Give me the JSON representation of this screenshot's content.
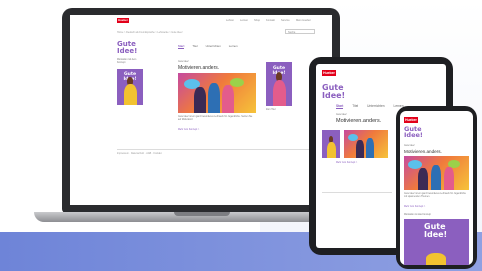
{
  "laptop": {
    "brand_label": "",
    "site": {
      "logo": "Hueber",
      "nav": [
        "Lehren",
        "Lernen",
        "Shop",
        "Kontakt",
        "Service",
        "Mein Hueber"
      ],
      "breadcrumb": "Home > Deutsch als Fremdsprache > Lehrwerke > Gute Idee!",
      "search_placeholder": "Suche",
      "logo_line1": "Gute",
      "logo_line2": "Idee!",
      "side_text": "Motivation mit dem Konzept",
      "tabs": [
        "Start",
        "Titel",
        "Unterrichten",
        "Lernen"
      ],
      "section_kicker": "Gute Idee!",
      "section_title": "Motivieren.anders.",
      "body_text": "Gute Idee! ist ein ganz besonderes Lehrwerk für Jugendliche. Setzen Sie auf Motivation!",
      "more_link": "Mehr zum Konzept >",
      "side_cover_label": "Gute Idee!",
      "side_caption": "Zum Titel",
      "footer_text": "Impressum · Datenschutz · AGB · Kontakt"
    }
  },
  "tablet": {
    "logo": "Hueber",
    "logo_line1": "Gute",
    "logo_line2": "Idee!",
    "tabs": [
      "Start",
      "Titel",
      "Unterrichten",
      "Lernen"
    ],
    "section_kicker": "Gute Idee!",
    "section_title": "Motivieren.anders.",
    "more_link": "Mehr zum Konzept >"
  },
  "phone": {
    "logo": "Hueber",
    "logo_line1": "Gute",
    "logo_line2": "Idee!",
    "section_kicker": "Gute Idee!",
    "section_title": "Motivieren.anders.",
    "body_text": "Gute Idee! ist ein ganz besonderes Lehrwerk für Jugendliche mit spannenden Themen.",
    "more_link": "Mehr zum Konzept >",
    "bottom_label": "Motivation ist das Konzept",
    "cover_line1": "Gute",
    "cover_line2": "Idee!"
  },
  "colors": {
    "brand_red": "#e2001a",
    "accent_purple": "#8b5fbf",
    "floor_blue": "#6e84d8"
  }
}
